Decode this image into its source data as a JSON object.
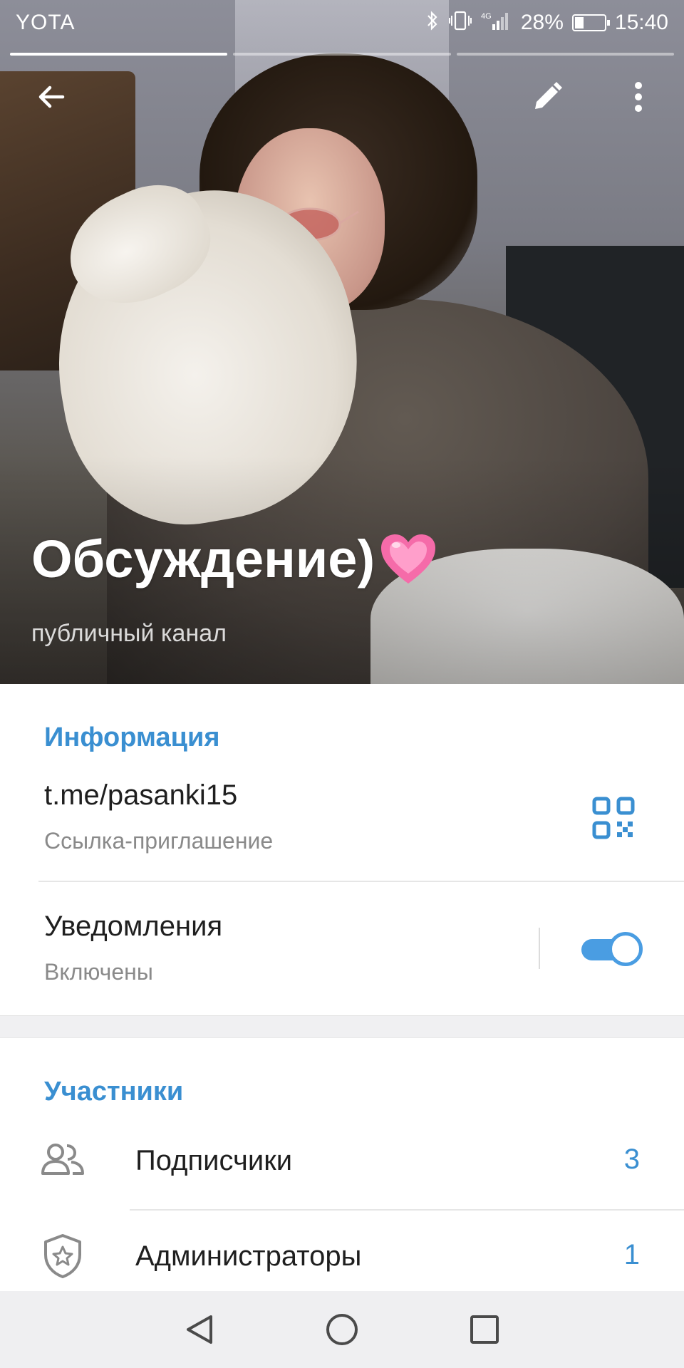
{
  "status_bar": {
    "carrier": "YOTA",
    "bluetooth_icon": "bluetooth-icon",
    "vibrate_icon": "vibrate-icon",
    "network": "4G",
    "battery_percent": "28%",
    "time": "15:40"
  },
  "stories": {
    "total": 3,
    "active_index": 0
  },
  "header": {
    "back_icon": "arrow-left-icon",
    "edit_icon": "pencil-icon",
    "more_icon": "more-vertical-icon",
    "title": "Обсуждение)",
    "title_emoji": "💗",
    "subtitle": "публичный канал"
  },
  "info": {
    "section_title": "Информация",
    "link": "t.me/pasanki15",
    "link_caption": "Ссылка-приглашение",
    "qr_icon": "qr-code-icon",
    "notifications_label": "Уведомления",
    "notifications_state": "Включены",
    "notifications_enabled": true
  },
  "members": {
    "section_title": "Участники",
    "items": [
      {
        "icon": "users-icon",
        "label": "Подписчики",
        "count": "3"
      },
      {
        "icon": "shield-star-icon",
        "label": "Администраторы",
        "count": "1"
      }
    ]
  },
  "nav": {
    "back": "triangle-back-icon",
    "home": "circle-home-icon",
    "recents": "square-recents-icon"
  },
  "colors": {
    "accent": "#3a8fd1",
    "toggle_on": "#4a9de2",
    "secondary_text": "#8a8a8a",
    "primary_text": "#1f1f1f",
    "nav_bg": "#efeff1"
  }
}
